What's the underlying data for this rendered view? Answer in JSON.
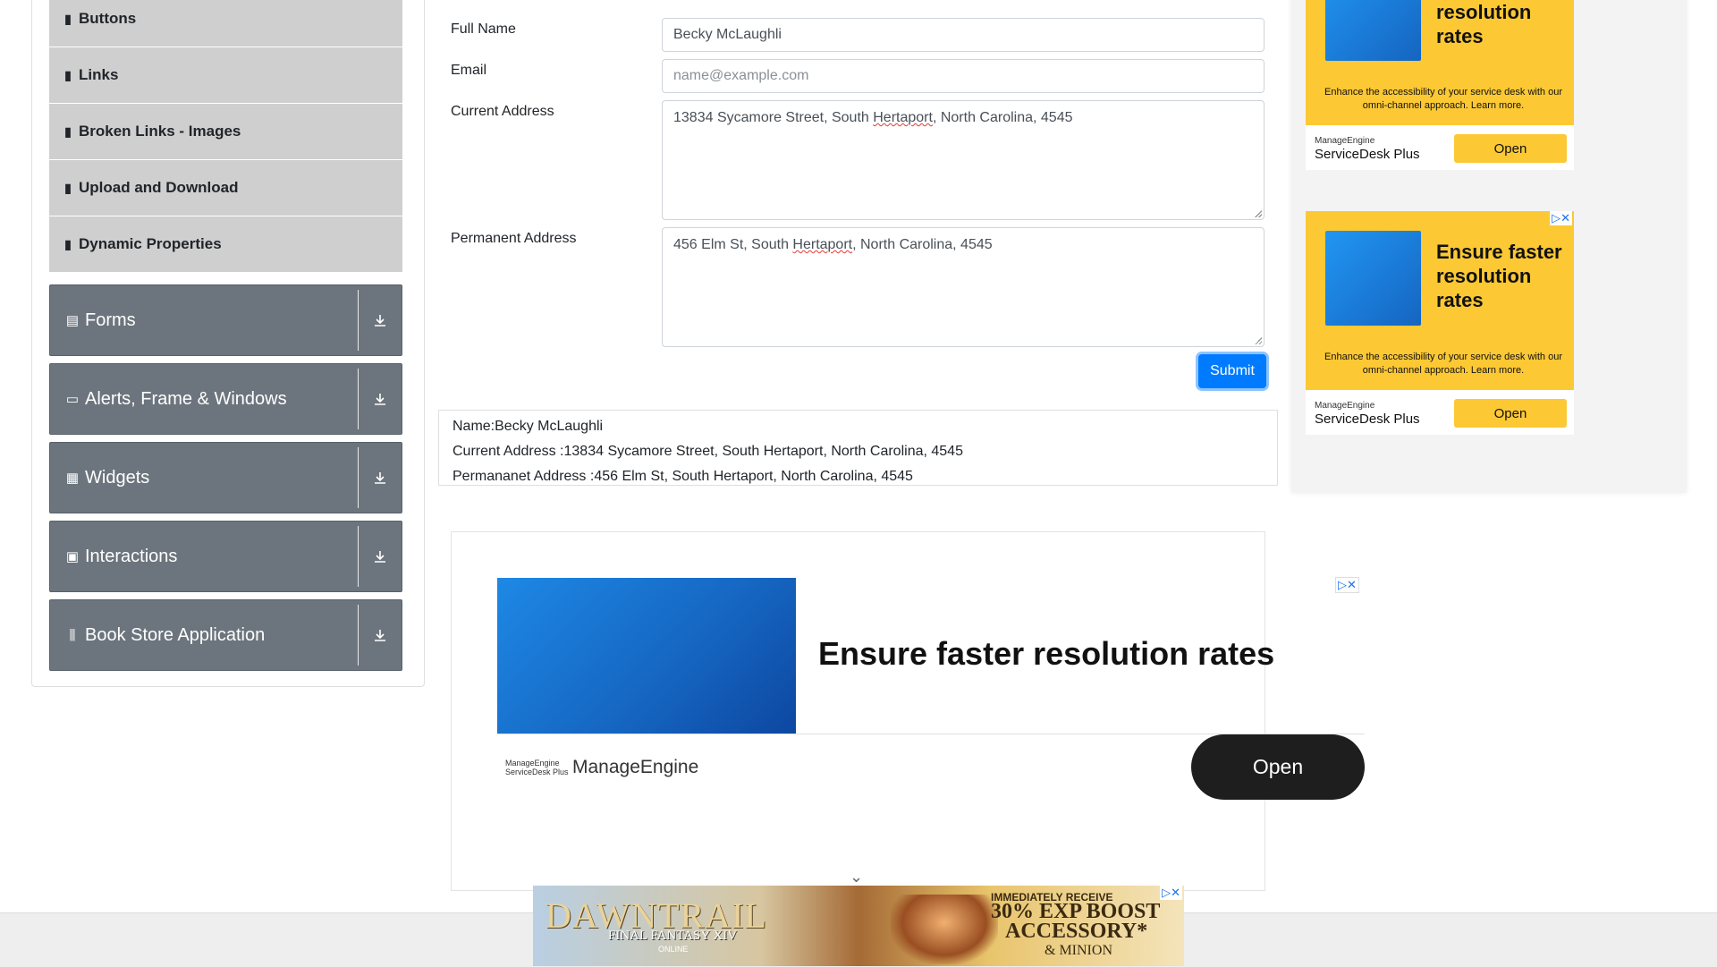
{
  "sidebar": {
    "sub_items": [
      {
        "label": "Buttons",
        "icon": "bookmark-icon"
      },
      {
        "label": "Links",
        "icon": "bookmark-icon"
      },
      {
        "label": "Broken Links - Images",
        "icon": "bookmark-icon"
      },
      {
        "label": "Upload and Download",
        "icon": "bookmark-icon"
      },
      {
        "label": "Dynamic Properties",
        "icon": "bookmark-icon"
      }
    ],
    "groups": [
      {
        "label": "Forms",
        "icon": "form-icon"
      },
      {
        "label": "Alerts, Frame & Windows",
        "icon": "window-icon"
      },
      {
        "label": "Widgets",
        "icon": "widgets-icon"
      },
      {
        "label": "Interactions",
        "icon": "interactions-icon"
      },
      {
        "label": "Book Store Application",
        "icon": "books-icon"
      }
    ]
  },
  "form": {
    "full_name_label": "Full Name",
    "full_name_value": "Becky McLaughli",
    "email_label": "Email",
    "email_placeholder": "name@example.com",
    "current_address_label": "Current Address",
    "current_address_pre": "13834 Sycamore Street, South ",
    "current_address_word": "Hertaport",
    "current_address_post": ", North Carolina, 4545",
    "permanent_address_label": "Permanent Address",
    "permanent_address_pre": "456 Elm St, South ",
    "permanent_address_word": "Hertaport",
    "permanent_address_post": ", North Carolina, 4545",
    "submit_label": "Submit"
  },
  "output": {
    "name_line": "Name:Becky McLaughli",
    "current_line": "Current Address :13834 Sycamore Street, South Hertaport, North Carolina, 4545",
    "permanent_line": "Permananet Address :456 Elm St, South Hertaport, North Carolina, 4545"
  },
  "ads": {
    "side_top": {
      "title": "resolution rates",
      "desc": "Enhance the accessibility of your service desk with our omni-channel approach. Learn more.",
      "brand_small": "ManageEngine",
      "brand_product": "ServiceDesk Plus",
      "open_label": "Open"
    },
    "side_bottom": {
      "title": "Ensure faster resolution rates",
      "desc": "Enhance the accessibility of your service desk with our omni-channel approach. Learn more.",
      "brand_small": "ManageEngine",
      "brand_product": "ServiceDesk Plus",
      "open_label": "Open"
    },
    "middle": {
      "title": "Ensure faster resolution rates",
      "brand_logo_1": "ManageEngine",
      "brand_logo_2": "ServiceDesk Plus",
      "brand": "ManageEngine",
      "open_label": "Open"
    },
    "banner": {
      "logo": "DAWNTRAIL",
      "sub": "FINAL FANTASY XIV",
      "sub2": "ONLINE",
      "line1": "IMMEDIATELY RECEIVE",
      "line2": "30% EXP BOOST",
      "line3": "ACCESSORY*",
      "line4": "& MINION"
    }
  },
  "colors": {
    "sidebar_group_bg": "#6c757d",
    "sidebar_item_bg": "#cfcfcf",
    "primary": "#007bff",
    "ad_yellow": "#fcc834"
  }
}
